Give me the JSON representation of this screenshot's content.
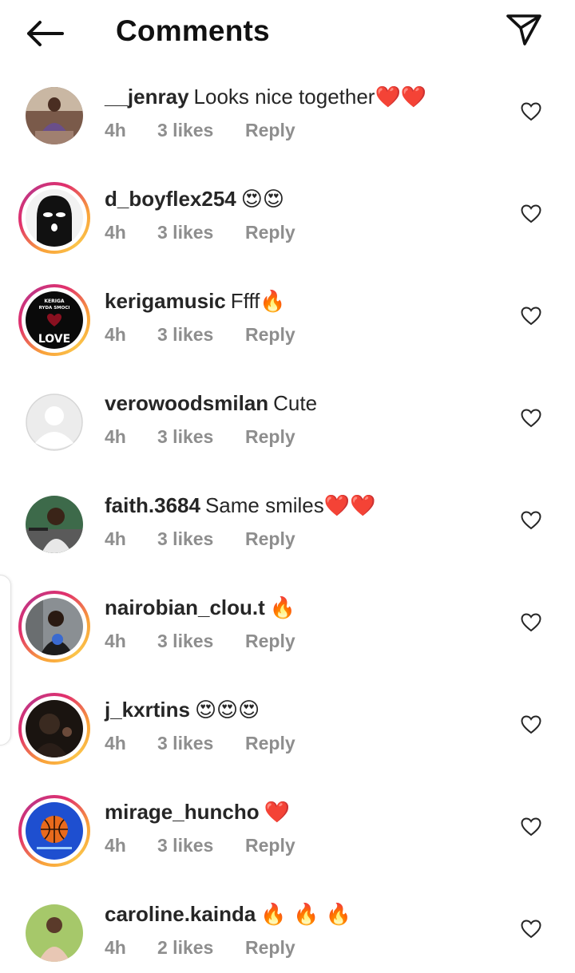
{
  "header": {
    "title": "Comments",
    "back_icon": "arrow-left-icon",
    "share_icon": "paper-plane-icon"
  },
  "comments": [
    {
      "username": "__jenray",
      "text": "Looks nice together",
      "emoji": "❤️❤️",
      "time": "4h",
      "likes": "3 likes",
      "reply": "Reply",
      "ring": false
    },
    {
      "username": "d_boyflex254",
      "text": "",
      "emoji": "😍😍",
      "time": "4h",
      "likes": "3 likes",
      "reply": "Reply",
      "ring": true
    },
    {
      "username": "kerigamusic",
      "text": "Ffff",
      "emoji": "🔥",
      "time": "4h",
      "likes": "3 likes",
      "reply": "Reply",
      "ring": true,
      "avatar_text_top": "KERIGA",
      "avatar_text_mid": "RYDA SMOCI",
      "avatar_text_bottom": "LOVE"
    },
    {
      "username": "verowoodsmilan",
      "text": "Cute",
      "emoji": "",
      "time": "4h",
      "likes": "3 likes",
      "reply": "Reply",
      "ring": false
    },
    {
      "username": "faith.3684",
      "text": "Same smiles",
      "emoji": "❤️❤️",
      "time": "4h",
      "likes": "3 likes",
      "reply": "Reply",
      "ring": false
    },
    {
      "username": "nairobian_clou.t",
      "text": "",
      "emoji": "🔥",
      "time": "4h",
      "likes": "3 likes",
      "reply": "Reply",
      "ring": true
    },
    {
      "username": "j_kxrtins",
      "text": "",
      "emoji": "😍😍😍",
      "time": "4h",
      "likes": "3 likes",
      "reply": "Reply",
      "ring": true
    },
    {
      "username": "mirage_huncho",
      "text": "",
      "emoji": "❤️",
      "time": "4h",
      "likes": "3 likes",
      "reply": "Reply",
      "ring": true
    },
    {
      "username": "caroline.kainda",
      "text": "",
      "emoji": "🔥 🔥 🔥",
      "time": "4h",
      "likes": "2 likes",
      "reply": "Reply",
      "ring": false
    }
  ],
  "colors": {
    "meta": "#8e8e8e",
    "text": "#262626",
    "heart_red": "#e0202e"
  }
}
